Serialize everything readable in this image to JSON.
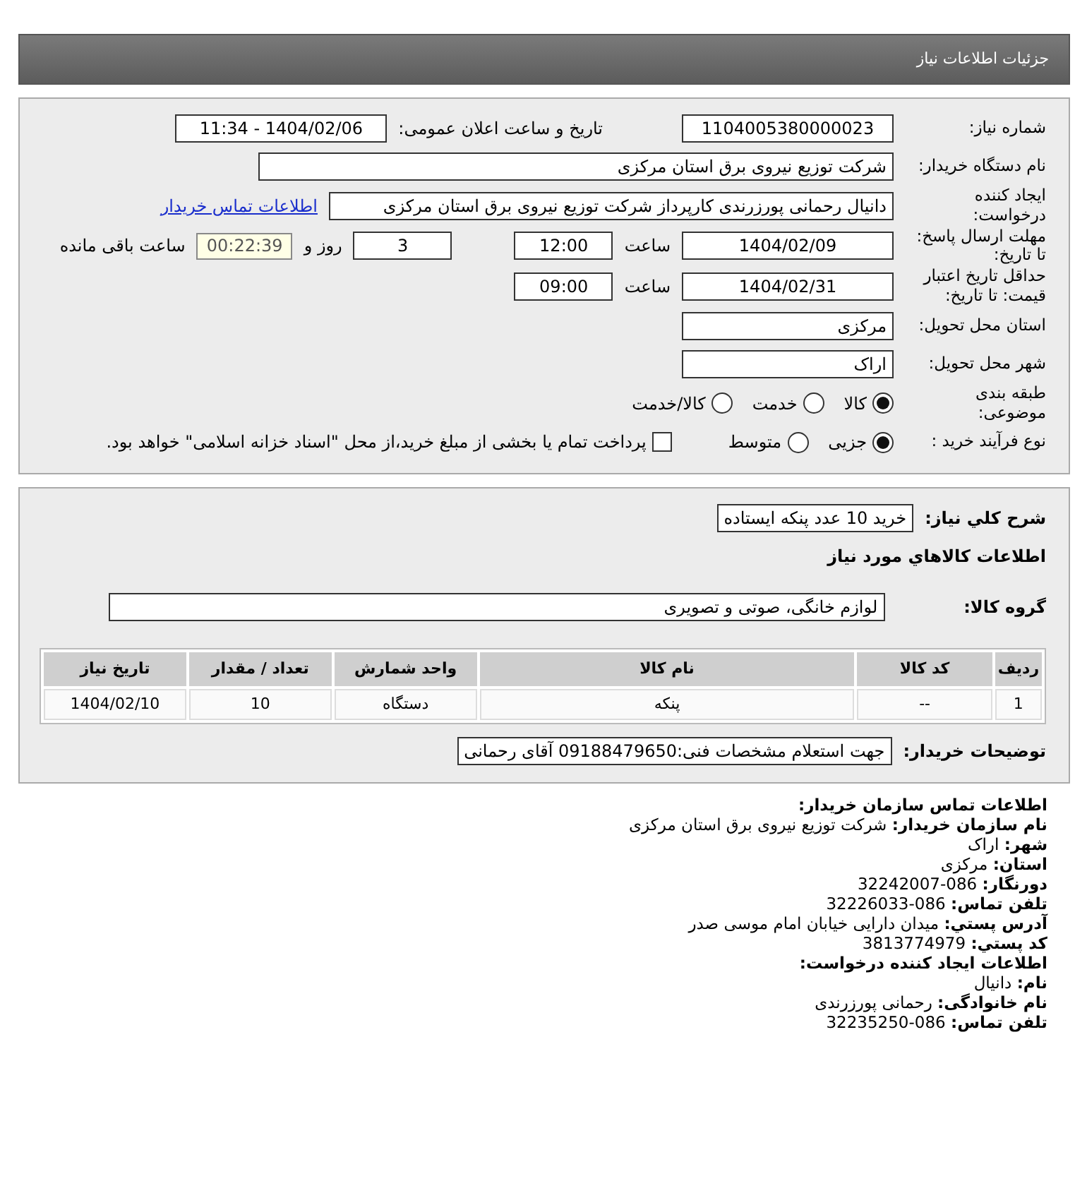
{
  "header": {
    "title": "جزئیات اطلاعات نیاز"
  },
  "details": {
    "need_number": {
      "label": "شماره نیاز:",
      "value": "1104005380000023"
    },
    "announce": {
      "label": "تاریخ و ساعت اعلان عمومی:",
      "value": "1404/02/06 - 11:34"
    },
    "buyer": {
      "label": "نام دستگاه خریدار:",
      "value": "شرکت توزیع نیروی برق استان مرکزی"
    },
    "creator": {
      "label": "ایجاد کننده درخواست:",
      "value": "دانیال رحمانی پورزرندی کارپرداز شرکت توزیع نیروی برق استان مرکزی",
      "link": "اطلاعات تماس خریدار"
    },
    "deadline": {
      "label": "مهلت ارسال پاسخ: تا تاریخ:",
      "date": "1404/02/09",
      "time_label": "ساعت",
      "time": "12:00",
      "days": "3",
      "days_label": "روز و",
      "remaining": "00:22:39",
      "remaining_label": "ساعت باقی مانده"
    },
    "validity": {
      "label": "حداقل تاریخ اعتبار قیمت: تا تاریخ:",
      "date": "1404/02/31",
      "time_label": "ساعت",
      "time": "09:00"
    },
    "province": {
      "label": "استان محل تحویل:",
      "value": "مرکزی"
    },
    "city": {
      "label": "شهر محل تحویل:",
      "value": "اراک"
    },
    "category": {
      "label": "طبقه بندی موضوعی:",
      "options": [
        {
          "label": "کالا",
          "selected": true
        },
        {
          "label": "خدمت",
          "selected": false
        },
        {
          "label": "کالا/خدمت",
          "selected": false
        }
      ]
    },
    "process": {
      "label": "نوع فرآیند خرید :",
      "options": [
        {
          "label": "جزیی",
          "selected": true
        },
        {
          "label": "متوسط",
          "selected": false
        }
      ],
      "treasury": {
        "checked": false,
        "label": "پرداخت تمام یا بخشی از مبلغ خرید،از محل \"اسناد خزانه اسلامی\" خواهد بود."
      }
    }
  },
  "summary": {
    "description": {
      "label": "شرح كلي نياز:",
      "value": "خرید 10 عدد پنکه ایستاده"
    },
    "goods_heading": "اطلاعات كالاهاي مورد نياز",
    "group": {
      "label": "گروه کالا:",
      "value": "لوازم خانگی، صوتی و تصویری"
    },
    "table": {
      "columns": [
        "ردیف",
        "کد کالا",
        "نام کالا",
        "واحد شمارش",
        "تعداد / مقدار",
        "تاریخ نیاز"
      ],
      "rows": [
        [
          "1",
          "--",
          "پنکه",
          "دستگاه",
          "10",
          "1404/02/10"
        ]
      ]
    },
    "buyer_notes": {
      "label": "توضیحات خریدار:",
      "value": "جهت استعلام مشخصات فنی:09188479650 آقای رحمانی"
    }
  },
  "contact": [
    {
      "kind": "heading",
      "label": "اطلاعات تماس سازمان خریدار:"
    },
    {
      "kind": "pair",
      "label": "نام سازمان خریدار:",
      "value": "شرکت توزیع نیروی برق استان مرکزی"
    },
    {
      "kind": "pair",
      "label": "شهر:",
      "value": "اراک"
    },
    {
      "kind": "pair",
      "label": "استان:",
      "value": "مرکزی"
    },
    {
      "kind": "pair",
      "label": "دورنگار:",
      "value": "086-32242007"
    },
    {
      "kind": "pair",
      "label": "تلفن تماس:",
      "value": "086-32226033"
    },
    {
      "kind": "pair",
      "label": "آدرس پستي:",
      "value": "میدان دارایی خیابان امام موسی صدر"
    },
    {
      "kind": "pair",
      "label": "کد پستي:",
      "value": "3813774979"
    },
    {
      "kind": "heading",
      "label": "اطلاعات ایجاد کننده درخواست:"
    },
    {
      "kind": "pair",
      "label": "نام:",
      "value": "دانیال"
    },
    {
      "kind": "pair",
      "label": "نام خانوادگی:",
      "value": "رحمانی پورزرندی"
    },
    {
      "kind": "pair",
      "label": "تلفن تماس:",
      "value": "086-32235250"
    }
  ]
}
